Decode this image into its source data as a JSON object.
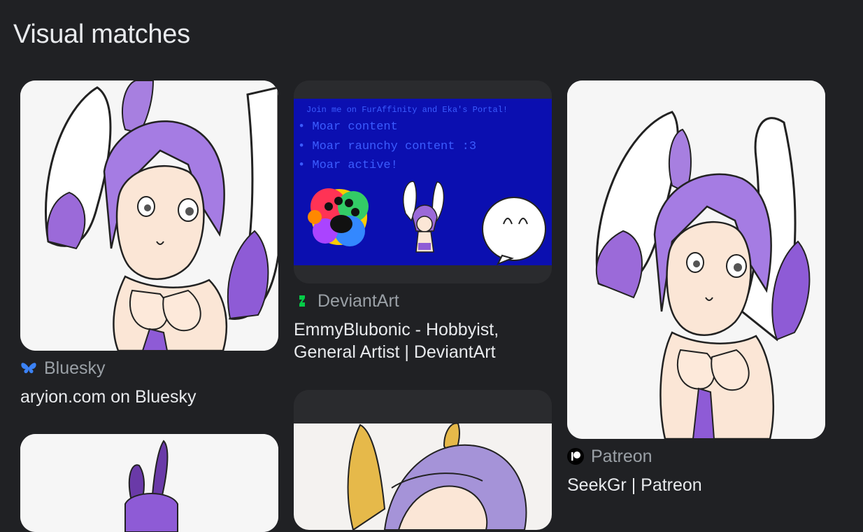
{
  "section": {
    "title": "Visual matches"
  },
  "results": [
    {
      "source": "Bluesky",
      "icon": "bluesky-butterfly-icon",
      "title": "aryion.com on Bluesky"
    },
    {
      "source": "DeviantArt",
      "icon": "deviantart-icon",
      "title": "EmmyBlubonic - Hobbyist, General Artist | DeviantArt",
      "image_text": [
        "Join me on FurAffinity and Eka's Portal!",
        "• Moar content",
        "• Moar raunchy content :3",
        "• Moar active!"
      ]
    },
    {
      "source": "Patreon",
      "icon": "patreon-icon",
      "title": "SeekGr | Patreon"
    }
  ],
  "colors": {
    "background": "#202124",
    "text": "#e8eaed",
    "muted": "#9aa0a6",
    "accent_purple": "#8e5bd6",
    "banner_blue": "#0b0fb0"
  }
}
